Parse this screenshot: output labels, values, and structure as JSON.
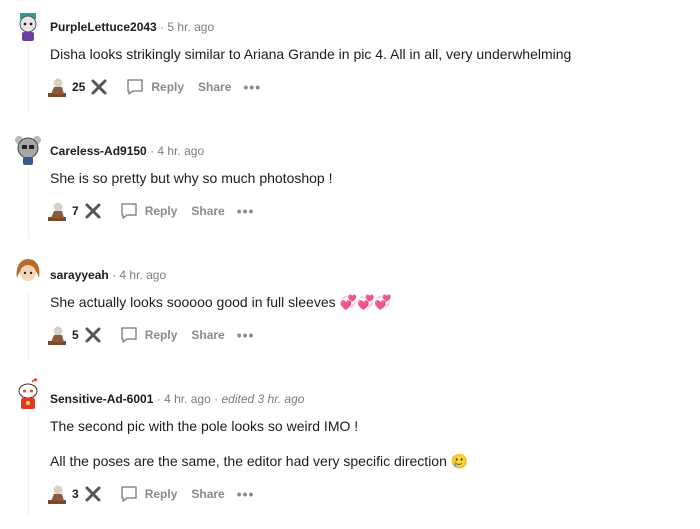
{
  "comments": [
    {
      "author": "PurpleLettuce2043",
      "time": "5 hr. ago",
      "body": [
        "Disha looks strikingly similar to Ariana Grande in pic 4. All in all, very underwhelming"
      ],
      "score": "25"
    },
    {
      "author": "Careless-Ad9150",
      "time": "4 hr. ago",
      "body": [
        "She is so pretty but why so much photoshop !"
      ],
      "score": "7"
    },
    {
      "author": "sarayyeah",
      "time": "4 hr. ago",
      "body": [
        "She actually looks sooooo good in full sleeves 💞💞💞"
      ],
      "score": "5"
    },
    {
      "author": "Sensitive-Ad-6001",
      "time": "4 hr. ago",
      "edited": "edited 3 hr. ago",
      "body": [
        "The second pic with the pole looks so weird IMO !",
        "All the poses are the same, the editor had very specific direction 🥲"
      ],
      "score": "3"
    }
  ],
  "labels": {
    "separator": "·",
    "reply": "Reply",
    "share": "Share",
    "more": "•••"
  },
  "colors": {
    "meta": "#7c7c7c",
    "action": "#878a8c",
    "thread_line": "#edeff1"
  }
}
